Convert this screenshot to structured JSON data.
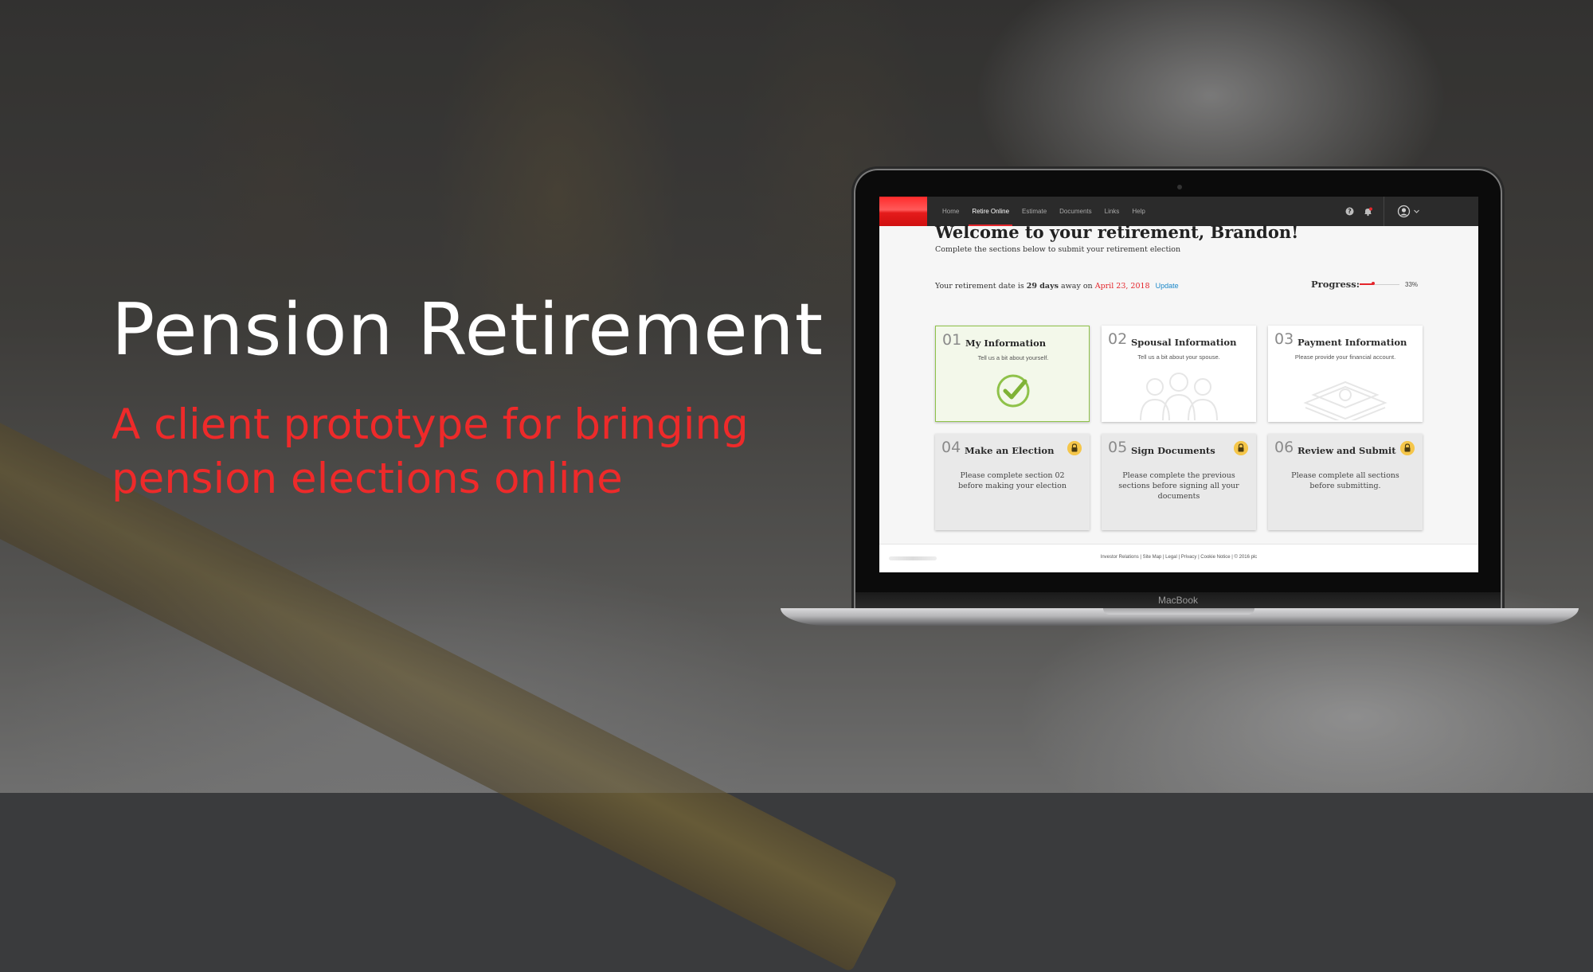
{
  "hero": {
    "title": "Pension Retirement",
    "subtitle": "A client prototype for bringing pension elections online"
  },
  "laptop": {
    "brand": "MacBook"
  },
  "app": {
    "nav": {
      "items": [
        "Home",
        "Retire Online",
        "Estimate",
        "Documents",
        "Links",
        "Help"
      ],
      "active": "Retire Online",
      "icons": [
        "question-icon",
        "notification-bell-icon",
        "user-avatar-icon",
        "chevron-down-icon"
      ]
    },
    "welcome": {
      "title": "Welcome to your retirement, Brandon!",
      "subtitle": "Complete the sections below to submit your retirement election"
    },
    "retirement": {
      "prefix": "Your retirement date is ",
      "days": "29 days",
      "middle": " away on ",
      "date": "April 23, 2018",
      "update": "Update"
    },
    "progress": {
      "label": "Progress:",
      "value": 0.33,
      "text": "33%"
    },
    "sections": [
      {
        "num": "01",
        "title": "My Information",
        "desc": "Tell us a bit about yourself.",
        "status": "complete"
      },
      {
        "num": "02",
        "title": "Spousal Information",
        "desc": "Tell us a bit about your spouse.",
        "status": "open"
      },
      {
        "num": "03",
        "title": "Payment Information",
        "desc": "Please provide your financial account.",
        "status": "open"
      },
      {
        "num": "04",
        "title": "Make an Election",
        "desc": "Please complete section 02 before making your election",
        "status": "locked"
      },
      {
        "num": "05",
        "title": "Sign Documents",
        "desc": "Please complete the previous sections before signing all your documents",
        "status": "locked"
      },
      {
        "num": "06",
        "title": "Review and Submit",
        "desc": "Please complete all sections before submitting.",
        "status": "locked"
      }
    ],
    "footer": {
      "links": "Investor Relations | Site Map | Legal | Privacy | Cookie Notice | © 2016 plc"
    }
  },
  "colors": {
    "accent": "#e4252b",
    "complete": "#8fc24a",
    "lock": "#f5c64a",
    "link": "#1a87c9"
  }
}
